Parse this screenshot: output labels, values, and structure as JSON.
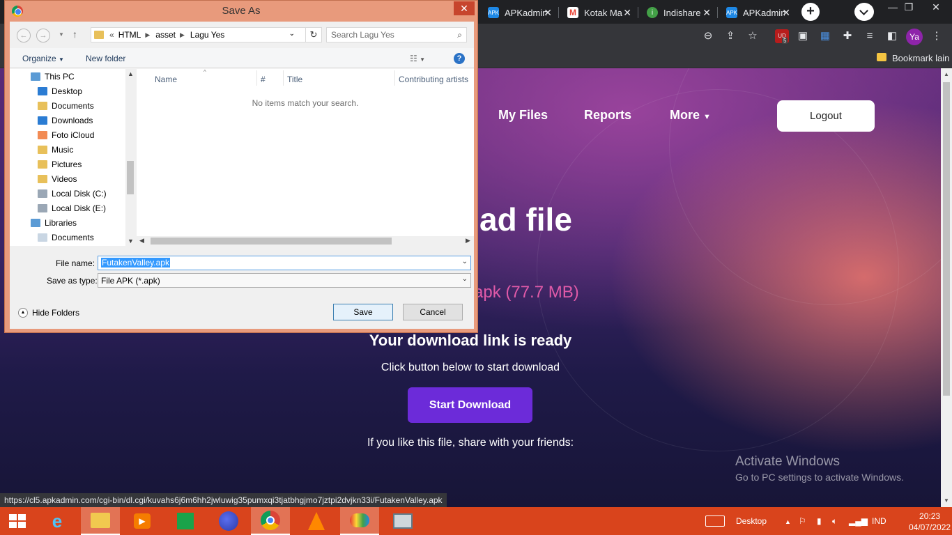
{
  "browser": {
    "tabs": [
      {
        "title": "APKadmin",
        "icon": "apk-favicon",
        "color": "#1e88e5"
      },
      {
        "title": "Kotak Ma",
        "icon": "gmail-favicon",
        "color": "#ea4335"
      },
      {
        "title": "Indishare",
        "icon": "info-favicon",
        "color": "#43a047"
      },
      {
        "title": "APKadmin",
        "icon": "apk-favicon",
        "color": "#1e88e5"
      }
    ],
    "profile_initials": "Ya",
    "extension_badge": "5",
    "bookmark_folder": "Bookmark lain",
    "status_url": "https://cl5.apkadmin.com/cgi-bin/dl.cgi/kuvahs6j6m6hh2jwluwig35pumxqi3tjatbhgjmo7jztpi2dvjkn33i/FutakenValley.apk"
  },
  "page": {
    "nav": {
      "my_files": "My Files",
      "reports": "Reports",
      "more": "More",
      "logout": "Logout"
    },
    "title_partial": "ad file",
    "filesize_partial": "apk (77.7 MB)",
    "ready_title": "Your download link is ready",
    "ready_sub": "Click button below to start download",
    "start_button": "Start Download",
    "share_text": "If you like this file, share with your friends:",
    "accent": "#6c2bd9"
  },
  "watermark": {
    "line1": "Activate Windows",
    "line2": "Go to PC settings to activate Windows."
  },
  "dialog": {
    "title": "Save As",
    "breadcrumb": [
      "HTML",
      "asset",
      "Lagu Yes"
    ],
    "breadcrumb_prefix": "«",
    "search_placeholder": "Search Lagu Yes",
    "organize": "Organize",
    "new_folder": "New folder",
    "nav_items": [
      {
        "label": "This PC",
        "icon": "computer-icon",
        "color": "#5b9bd5"
      },
      {
        "label": "Desktop",
        "icon": "folder-icon",
        "color": "#2b7cd3"
      },
      {
        "label": "Documents",
        "icon": "folder-icon",
        "color": "#e8c05a"
      },
      {
        "label": "Downloads",
        "icon": "folder-icon",
        "color": "#2b7cd3"
      },
      {
        "label": "Foto iCloud",
        "icon": "icloud-icon",
        "color": "#f28b54"
      },
      {
        "label": "Music",
        "icon": "folder-icon",
        "color": "#e8c05a"
      },
      {
        "label": "Pictures",
        "icon": "folder-icon",
        "color": "#e8c05a"
      },
      {
        "label": "Videos",
        "icon": "folder-icon",
        "color": "#e8c05a"
      },
      {
        "label": "Local Disk (C:)",
        "icon": "drive-icon",
        "color": "#9aa7b5"
      },
      {
        "label": "Local Disk (E:)",
        "icon": "drive-icon",
        "color": "#9aa7b5"
      },
      {
        "label": "Libraries",
        "icon": "library-icon",
        "color": "#5b9bd5"
      },
      {
        "label": "Documents",
        "icon": "document-icon",
        "color": "#c9d6e3"
      }
    ],
    "columns": [
      "Name",
      "#",
      "Title",
      "Contributing artists"
    ],
    "empty_message": "No items match your search.",
    "file_name_label": "File name:",
    "file_name_value": "FutakenValley.apk",
    "save_type_label": "Save as type:",
    "save_type_value": "File APK (*.apk)",
    "hide_folders": "Hide Folders",
    "save": "Save",
    "cancel": "Cancel"
  },
  "taskbar": {
    "desktop_label": "Desktop",
    "language": "IND",
    "time": "20:23",
    "date": "04/07/2022",
    "apps": [
      "internet-explorer-icon",
      "file-explorer-icon",
      "media-player-icon",
      "store-icon",
      "firefox-icon",
      "chrome-icon",
      "vlc-icon",
      "paint-icon",
      "monitor-icon"
    ]
  }
}
